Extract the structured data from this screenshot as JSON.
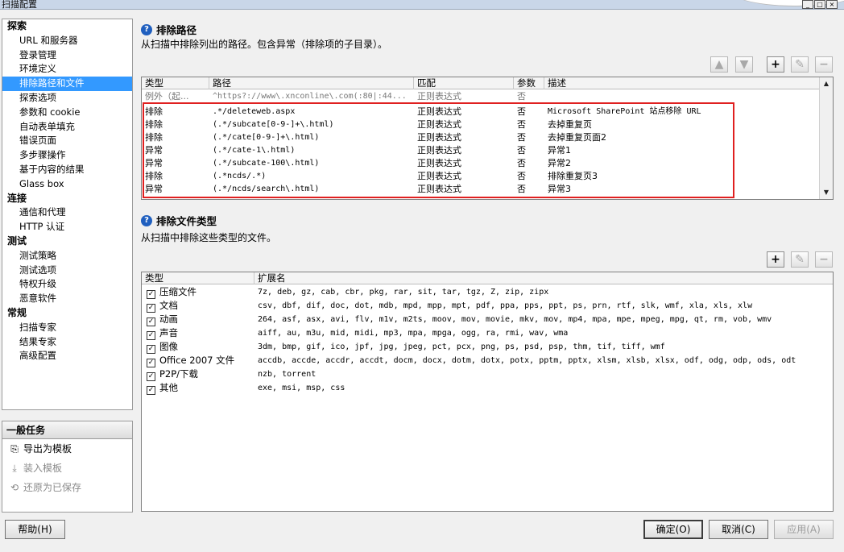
{
  "window": {
    "title": "扫描配置"
  },
  "nav": {
    "categories": [
      {
        "label": "探索",
        "items": [
          "URL 和服务器",
          "登录管理",
          "环境定义",
          "排除路径和文件",
          "探索选项",
          "参数和 cookie",
          "自动表单填充",
          "错误页面",
          "多步骤操作",
          "基于内容的结果",
          "Glass box"
        ]
      },
      {
        "label": "连接",
        "items": [
          "通信和代理",
          "HTTP 认证"
        ]
      },
      {
        "label": "测试",
        "items": [
          "测试策略",
          "测试选项",
          "特权升级",
          "恶意软件"
        ]
      },
      {
        "label": "常规",
        "items": [
          "扫描专家",
          "结果专家",
          "高级配置"
        ]
      }
    ],
    "selected": "排除路径和文件"
  },
  "tasks": {
    "title": "一般任务",
    "items": [
      {
        "label": "导出为模板",
        "icon": "export-icon",
        "enabled": true
      },
      {
        "label": "装入模板",
        "icon": "load-template-icon",
        "enabled": false
      },
      {
        "label": "还原为已保存",
        "icon": "restore-icon",
        "enabled": false
      }
    ]
  },
  "exclude_paths": {
    "title": "排除路径",
    "description": "从扫描中排除列出的路径。包含异常（排除项的子目录）。",
    "columns": [
      "类型",
      "路径",
      "匹配",
      "参数",
      "描述"
    ],
    "rows": [
      {
        "type": "例外（起...",
        "path": "^https?://www\\.xnconline\\.com(:80|:44...",
        "match": "正则表达式",
        "param": "否",
        "desc": ""
      },
      {
        "type": "排除",
        "path": ".*/deleteweb.aspx",
        "match": "正则表达式",
        "param": "否",
        "desc": "Microsoft SharePoint 站点移除 URL"
      },
      {
        "type": "排除",
        "path": "(.*/subcate[0-9-]+\\.html)",
        "match": "正则表达式",
        "param": "否",
        "desc": "去掉重复页"
      },
      {
        "type": "排除",
        "path": "(.*/cate[0-9-]+\\.html)",
        "match": "正则表达式",
        "param": "否",
        "desc": "去掉重复页面2"
      },
      {
        "type": "异常",
        "path": "(.*/cate-1\\.html)",
        "match": "正则表达式",
        "param": "否",
        "desc": "异常1"
      },
      {
        "type": "异常",
        "path": "(.*/subcate-100\\.html)",
        "match": "正则表达式",
        "param": "否",
        "desc": "异常2"
      },
      {
        "type": "排除",
        "path": "(.*ncds/.*)",
        "match": "正则表达式",
        "param": "否",
        "desc": "排除重复页3"
      },
      {
        "type": "异常",
        "path": "(.*/ncds/search\\.html)",
        "match": "正则表达式",
        "param": "否",
        "desc": "异常3"
      }
    ]
  },
  "exclude_files": {
    "title": "排除文件类型",
    "description": "从扫描中排除这些类型的文件。",
    "columns": [
      "类型",
      "扩展名"
    ],
    "rows": [
      {
        "type": "压缩文件",
        "checked": true,
        "ext": "7z, deb, gz, cab, cbr, pkg, rar, sit, tar, tgz, Z, zip, zipx"
      },
      {
        "type": "文档",
        "checked": true,
        "ext": "csv, dbf, dif, doc, dot, mdb, mpd, mpp, mpt, pdf, ppa, pps, ppt, ps, prn, rtf, slk, wmf, xla, xls, xlw"
      },
      {
        "type": "动画",
        "checked": true,
        "ext": "264, asf, asx, avi, flv, m1v, m2ts, moov, mov, movie, mkv, mov, mp4, mpa, mpe, mpeg, mpg, qt, rm, vob, wmv"
      },
      {
        "type": "声音",
        "checked": true,
        "ext": "aiff, au, m3u, mid, midi, mp3, mpa, mpga, ogg, ra, rmi, wav, wma"
      },
      {
        "type": "图像",
        "checked": true,
        "ext": "3dm, bmp, gif, ico, jpf, jpg, jpeg, pct, pcx, png, ps, psd, psp, thm, tif, tiff, wmf"
      },
      {
        "type": "Office 2007 文件",
        "checked": true,
        "ext": "accdb, accde, accdr, accdt, docm, docx, dotm, dotx, potx, pptm, pptx, xlsm, xlsb, xlsx, odf, odg, odp, ods, odt"
      },
      {
        "type": "P2P/下载",
        "checked": true,
        "ext": "nzb, torrent"
      },
      {
        "type": "其他",
        "checked": true,
        "ext": "exe, msi, msp, css"
      }
    ]
  },
  "buttons": {
    "help": "帮助(H)",
    "ok": "确定(O)",
    "cancel": "取消(C)",
    "apply": "应用(A)"
  },
  "toolbar_icons": {
    "up": "▲",
    "down": "▼",
    "add": "+",
    "edit": "✎",
    "remove": "−"
  }
}
